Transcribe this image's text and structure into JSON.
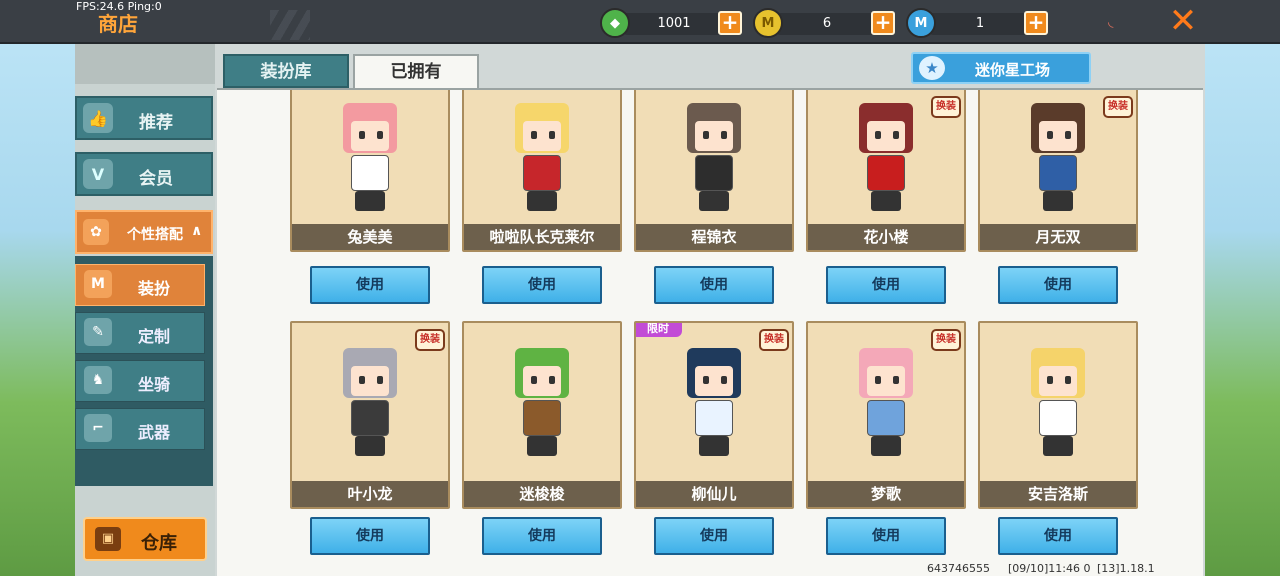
{
  "debug": {
    "fps_text": "FPS:24.6  Ping:0"
  },
  "header": {
    "title": "商店",
    "close_glyph": "✕"
  },
  "currencies": [
    {
      "icon": "green-gem-icon",
      "value": "1001",
      "color": "#4fb34a",
      "plus": "+"
    },
    {
      "icon": "mini-coin-icon",
      "value": "6",
      "color": "#e7c22e",
      "plus": "+"
    },
    {
      "icon": "mini-bean-icon",
      "value": "1",
      "color": "#3aa0dc",
      "plus": "+"
    }
  ],
  "sidebar": {
    "items": [
      {
        "label": "推荐",
        "icon": "thumbs-up-icon"
      },
      {
        "label": "会员",
        "icon": "vip-icon"
      }
    ],
    "group": {
      "label": "个性搭配",
      "arrow": "∧",
      "icon": "style-icon"
    },
    "sub_items": [
      {
        "label": "装扮",
        "icon": "costume-icon",
        "active": true
      },
      {
        "label": "定制",
        "icon": "pencil-icon",
        "active": false
      },
      {
        "label": "坐骑",
        "icon": "mount-icon",
        "active": false
      },
      {
        "label": "武器",
        "icon": "gun-icon",
        "active": false
      }
    ],
    "warehouse": {
      "label": "仓库",
      "icon": "warehouse-icon"
    }
  },
  "tabs": [
    {
      "label": "装扮库",
      "active": false
    },
    {
      "label": "已拥有",
      "active": true
    }
  ],
  "workshop": {
    "label": "迷你星工场",
    "icon": "star-icon"
  },
  "use_label": "使用",
  "skins_row1": [
    {
      "name": "兔美美",
      "hair": "#f39aa0",
      "outfit": "#ffffff",
      "badge": ""
    },
    {
      "name": "啦啦队长克莱尔",
      "hair": "#f6d66b",
      "outfit": "#c6262b",
      "badge": ""
    },
    {
      "name": "程锦衣",
      "hair": "#6b5a4e",
      "outfit": "#2d2d2d",
      "badge": ""
    },
    {
      "name": "花小楼",
      "hair": "#8a2d2d",
      "outfit": "#c81e1e",
      "badge": "换装"
    },
    {
      "name": "月无双",
      "hair": "#5a3b2a",
      "outfit": "#2f5fa6",
      "badge": "换装"
    }
  ],
  "skins_row2": [
    {
      "name": "叶小龙",
      "hair": "#a9a9b3",
      "outfit": "#3b3b3b",
      "badge": "换装"
    },
    {
      "name": "迷梭梭",
      "hair": "#5fb343",
      "outfit": "#8b5a2b",
      "badge": ""
    },
    {
      "name": "柳仙儿",
      "hair": "#1f3a5c",
      "outfit": "#e9f3ff",
      "badge": "换装",
      "limited": "限时"
    },
    {
      "name": "梦歌",
      "hair": "#f4a8b8",
      "outfit": "#6fa3dc",
      "badge": "换装"
    },
    {
      "name": "安吉洛斯",
      "hair": "#f5d36a",
      "outfit": "#ffffff",
      "badge": ""
    }
  ],
  "footer": {
    "id": "643746555",
    "date": "[09/10]11:46 0",
    "version": "[13]1.18.1"
  }
}
